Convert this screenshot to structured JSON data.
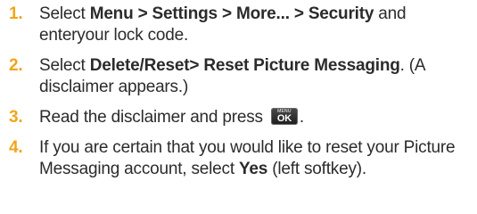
{
  "steps": [
    {
      "number": "1.",
      "t1": "Select ",
      "b1": "Menu > Settings > More... > Security",
      "t2": " and enteryour lock code."
    },
    {
      "number": "2.",
      "t1": "Select ",
      "b1": "Delete/Reset> Reset Picture Messaging",
      "t2": ". (A disclaimer appears.)"
    },
    {
      "number": "3.",
      "t1": "Read the disclaimer and press ",
      "key_top": "MENU",
      "key_main": "OK",
      "t2": "."
    },
    {
      "number": "4.",
      "t1": "If you are certain that you would like to reset your Picture Messaging account, select ",
      "b1": "Yes",
      "t2": " (left softkey)."
    }
  ],
  "colors": {
    "step_number": "#f2a51a",
    "text": "#2b2b2b",
    "key_bg": "#2a2a2a"
  }
}
